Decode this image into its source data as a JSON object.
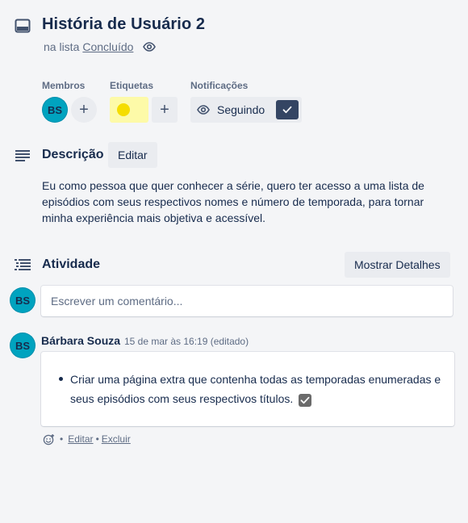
{
  "card": {
    "title": "História de Usuário 2",
    "list_prefix": "na lista",
    "list_name": "Concluído"
  },
  "members": {
    "label": "Membros",
    "avatar_initials": "BS",
    "add_icon": "+"
  },
  "labels": {
    "label": "Etiquetas",
    "chip_color": "#fdfaa8",
    "dot_color": "#f5dd00",
    "add_icon": "+"
  },
  "notifications": {
    "label": "Notificações",
    "button_label": "Seguindo"
  },
  "description": {
    "title": "Descrição",
    "edit_label": "Editar",
    "text": "Eu como pessoa que quer conhecer a série, quero ter acesso a uma lista de episódios com seus respectivos nomes e número de temporada, para tornar minha experiência mais objetiva e acessível."
  },
  "activity": {
    "title": "Atividade",
    "details_button": "Mostrar Detalhes",
    "current_user_initials": "BS",
    "comment_placeholder": "Escrever um comentário...",
    "comments": [
      {
        "avatar_initials": "BS",
        "author": "Bárbara Souza",
        "timestamp": "15 de mar às 16:19 (editado)",
        "body": "Criar uma página extra que contenha todas as temporadas enumeradas e seus episódios com seus respectivos títulos.",
        "edit_label": "Editar",
        "delete_label": "Excluir",
        "separator": "•"
      }
    ]
  },
  "colors": {
    "background": "#f4f5f7",
    "avatar": "#00a3bf",
    "follow_check": "#344563"
  }
}
